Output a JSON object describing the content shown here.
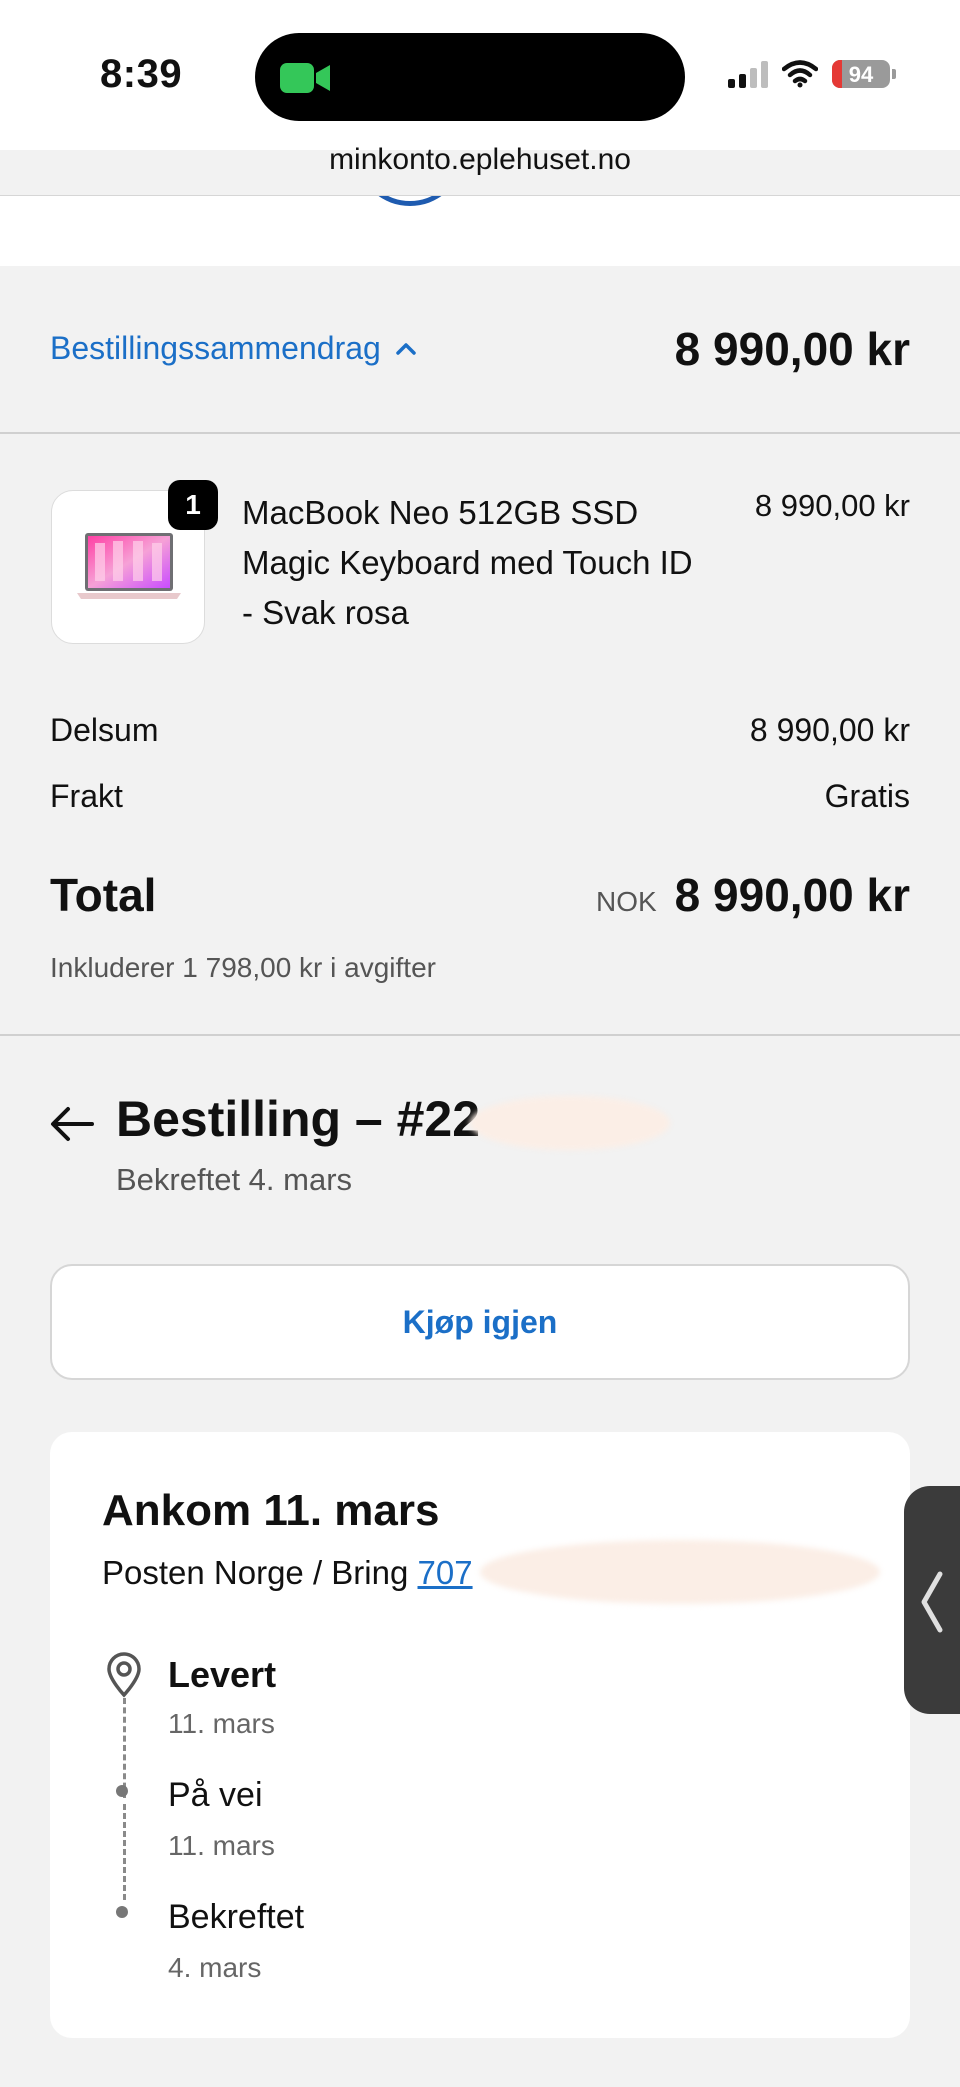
{
  "status_bar": {
    "time": "8:39",
    "battery": "94"
  },
  "browser": {
    "url": "minkonto.eplehuset.no"
  },
  "summary": {
    "toggle_label": "Bestillingssammendrag",
    "total": "8 990,00 kr"
  },
  "product": {
    "quantity": "1",
    "name": "MacBook Neo 512GB SSD Magic Keyboard med Touch ID - Svak rosa",
    "price": "8 990,00 kr"
  },
  "totals": {
    "subtotal_label": "Delsum",
    "subtotal_value": "8 990,00 kr",
    "shipping_label": "Frakt",
    "shipping_value": "Gratis",
    "total_label": "Total",
    "currency": "NOK",
    "total_value": "8 990,00 kr",
    "tax_note": "Inkluderer 1 798,00 kr i avgifter"
  },
  "order": {
    "title": "Bestilling – #22",
    "confirmed": "Bekreftet 4. mars",
    "buy_again_label": "Kjøp igjen"
  },
  "delivery": {
    "title": "Ankom 11. mars",
    "carrier": "Posten Norge / Bring ",
    "tracking_partial": "707",
    "steps": [
      {
        "label": "Levert",
        "date": "11. mars"
      },
      {
        "label": "På vei",
        "date": "11. mars"
      },
      {
        "label": "Bekreftet",
        "date": "4. mars"
      }
    ]
  },
  "colors": {
    "accent": "#1b6fc7",
    "background": "#f2f2f2"
  }
}
